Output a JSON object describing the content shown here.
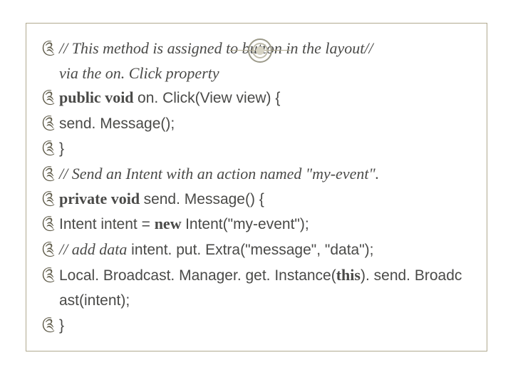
{
  "bullet_glyph": "༊",
  "lines": [
    {
      "bullet": true,
      "spans": [
        {
          "t": "// This method is assigned to button in the layout// ",
          "cls": "italic serif"
        }
      ]
    },
    {
      "bullet": false,
      "cont": true,
      "spans": [
        {
          "t": "via the on. Click property",
          "cls": "italic serif"
        }
      ]
    },
    {
      "bullet": true,
      "spans": [
        {
          "t": "public void ",
          "cls": "bold serif"
        },
        {
          "t": "on. Click(View view) {",
          "cls": "sans"
        }
      ]
    },
    {
      "bullet": true,
      "spans": [
        {
          "t": " send. Message();",
          "cls": "sans"
        }
      ]
    },
    {
      "bullet": true,
      "spans": [
        {
          "t": " }",
          "cls": "sans"
        }
      ]
    },
    {
      "bullet": true,
      "spans": [
        {
          "t": "// Send an Intent with an action named \"my-event\".",
          "cls": "italic serif"
        }
      ]
    },
    {
      "bullet": true,
      "spans": [
        {
          "t": "private void ",
          "cls": "bold serif"
        },
        {
          "t": "send. Message() {",
          "cls": "sans"
        }
      ]
    },
    {
      "bullet": true,
      "spans": [
        {
          "t": " Intent intent = ",
          "cls": "sans"
        },
        {
          "t": "new ",
          "cls": "bold serif"
        },
        {
          "t": "Intent(\"my-event\");",
          "cls": "sans"
        }
      ]
    },
    {
      "bullet": true,
      "spans": [
        {
          "t": " // add data",
          "cls": "italic serif"
        },
        {
          "t": "  intent. put. Extra(\"message\", \"data\");",
          "cls": "sans"
        }
      ]
    },
    {
      "bullet": true,
      "spans": [
        {
          "t": " Local. Broadcast. Manager. get. Instance(",
          "cls": "sans"
        },
        {
          "t": "this",
          "cls": "bold serif"
        },
        {
          "t": "). send. Broadc",
          "cls": "sans"
        }
      ]
    },
    {
      "bullet": false,
      "cont": true,
      "spans": [
        {
          "t": "ast(intent);",
          "cls": "sans"
        }
      ]
    },
    {
      "bullet": true,
      "spans": [
        {
          "t": " }",
          "cls": "sans"
        }
      ]
    }
  ]
}
